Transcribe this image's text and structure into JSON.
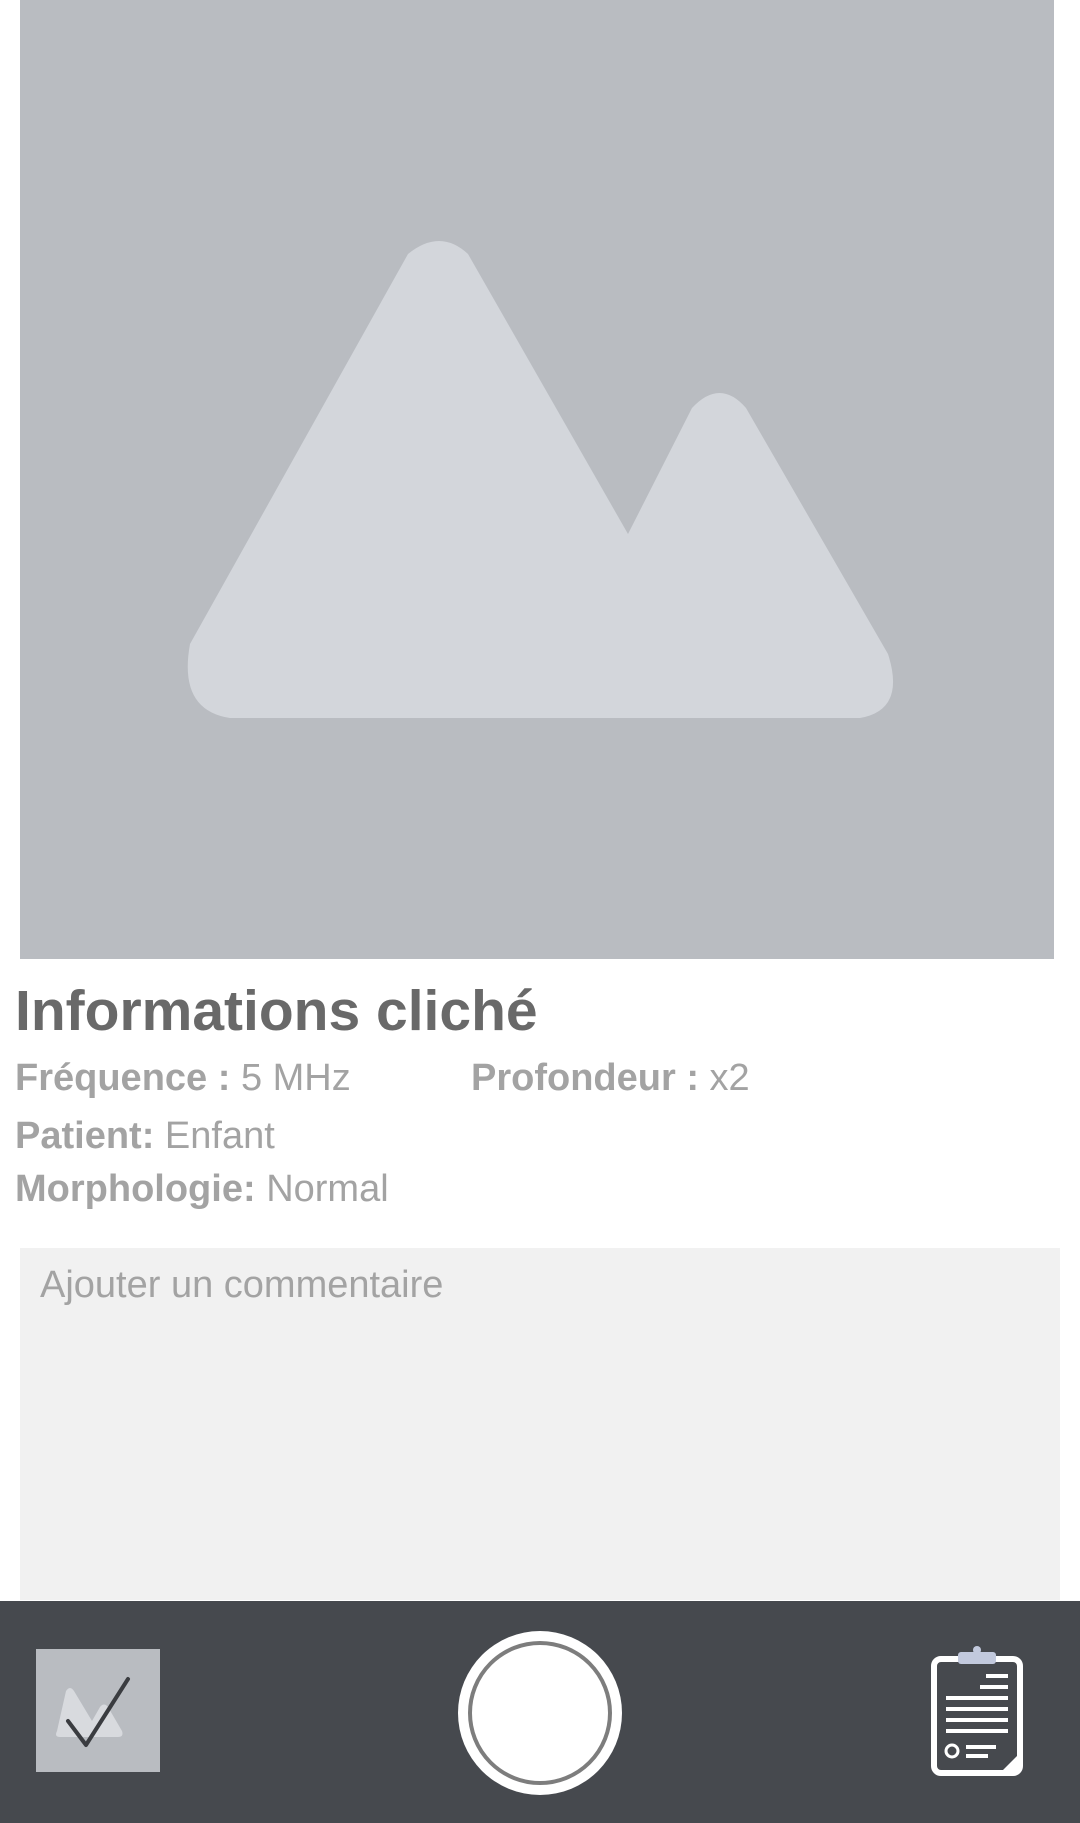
{
  "preview": {
    "icon": "image-placeholder-icon",
    "background": "#b9bcc1",
    "glyph_color": "#d3d6db"
  },
  "info": {
    "title": "Informations cliché",
    "frequency": {
      "label": "Fréquence :",
      "value": "5 MHz"
    },
    "depth": {
      "label": "Profondeur :",
      "value": "x2"
    },
    "patient": {
      "label": "Patient:",
      "value": "Enfant"
    },
    "morphology": {
      "label": "Morphologie:",
      "value": "Normal"
    }
  },
  "comment": {
    "placeholder": "Ajouter un commentaire",
    "value": ""
  },
  "bottom_bar": {
    "background": "#46494e",
    "thumbnail_icon": "image-check-icon",
    "capture_icon": "shutter-button-icon",
    "report_icon": "clipboard-report-icon"
  }
}
